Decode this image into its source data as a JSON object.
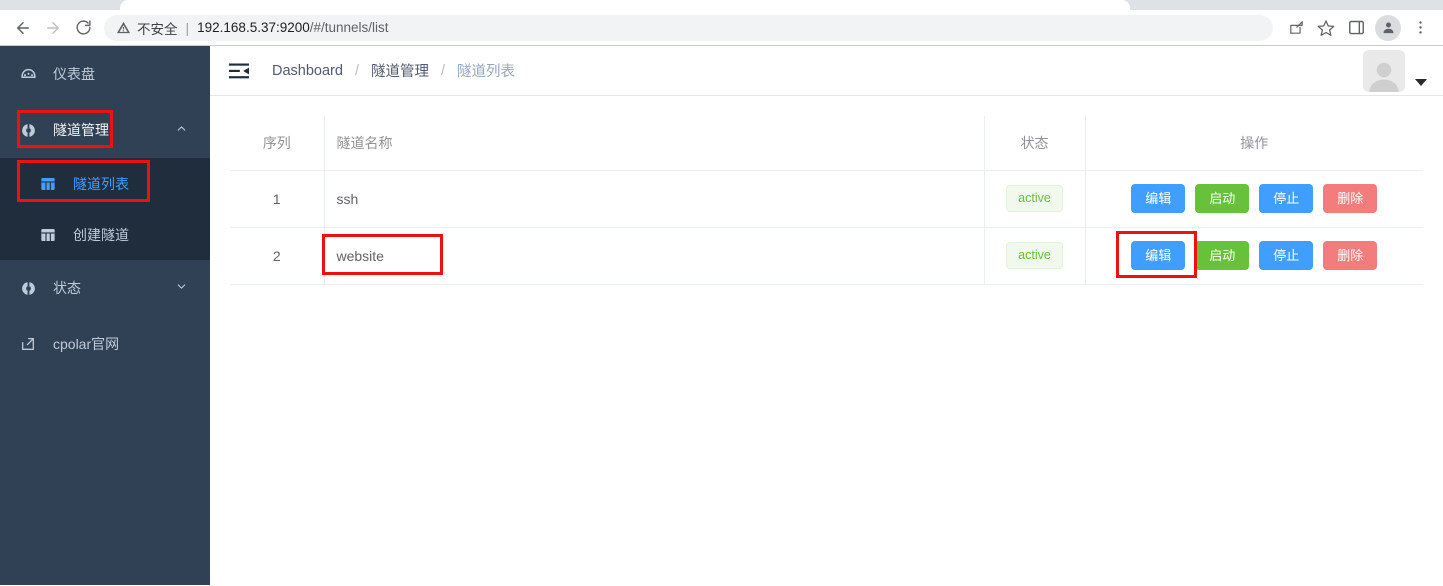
{
  "browser": {
    "back_label": "back",
    "forward_label": "forward",
    "reload_label": "reload",
    "security_text": "不安全",
    "url_host": "192.168.5.37:9200",
    "url_path": "/#/tunnels/list",
    "share_label": "share",
    "bookmark_label": "bookmark",
    "sidepanel_label": "side panel",
    "profile_label": "profile",
    "menu_label": "menu"
  },
  "sidebar": {
    "items": [
      {
        "label": "仪表盘",
        "icon": "dashboard-icon",
        "type": "item"
      },
      {
        "label": "隧道管理",
        "icon": "tunnel-icon",
        "type": "group",
        "expanded": true,
        "arrow": "chevron-up-icon"
      },
      {
        "label": "状态",
        "icon": "status-icon",
        "type": "group",
        "expanded": false,
        "arrow": "chevron-down-icon"
      },
      {
        "label": "cpolar官网",
        "icon": "external-link-icon",
        "type": "link"
      }
    ],
    "submenu": [
      {
        "label": "隧道列表",
        "icon": "grid-icon",
        "active": true
      },
      {
        "label": "创建隧道",
        "icon": "grid-icon",
        "active": false
      }
    ]
  },
  "navbar": {
    "hamburger": "hamburger-fold-icon",
    "breadcrumb": [
      "Dashboard",
      "隧道管理",
      "隧道列表"
    ],
    "breadcrumb_sep": "/",
    "avatar": "user-avatar"
  },
  "table": {
    "columns": [
      "序列",
      "隧道名称",
      "状态",
      "操作"
    ],
    "rows": [
      {
        "index": "1",
        "name": "ssh",
        "status": "active",
        "actions": [
          {
            "label": "编辑",
            "style": "primary"
          },
          {
            "label": "启动",
            "style": "success"
          },
          {
            "label": "停止",
            "style": "primary"
          },
          {
            "label": "删除",
            "style": "danger"
          }
        ]
      },
      {
        "index": "2",
        "name": "website",
        "status": "active",
        "actions": [
          {
            "label": "编辑",
            "style": "primary"
          },
          {
            "label": "启动",
            "style": "success"
          },
          {
            "label": "停止",
            "style": "primary"
          },
          {
            "label": "删除",
            "style": "danger"
          }
        ]
      }
    ]
  },
  "colors": {
    "sidebar_bg": "#304156",
    "submenu_bg": "#1f2d3d",
    "accent": "#409eff",
    "success": "#67c23a",
    "danger": "#f37c7c",
    "annotation": "#ee1111"
  }
}
